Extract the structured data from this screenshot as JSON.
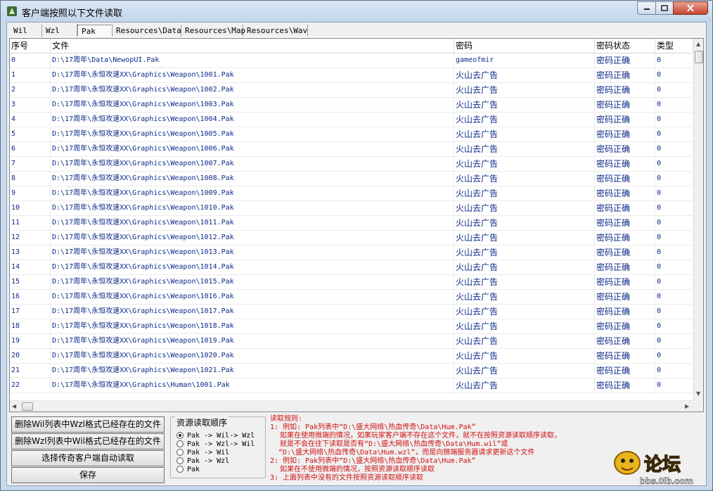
{
  "window": {
    "title": "客户端按照以下文件读取"
  },
  "tabs": [
    "Wil",
    "Wzl",
    "Pak",
    "Resources\\Data",
    "Resources\\Map",
    "Resources\\Wav"
  ],
  "active_tab": "Pak",
  "list": {
    "columns": [
      "序号",
      "文件",
      "密码",
      "密码状态",
      "类型"
    ],
    "rows": [
      [
        "0",
        "D:\\17周年\\Data\\NewopUI.Pak",
        "gameofmir",
        "密码正确",
        "0"
      ],
      [
        "1",
        "D:\\17周年\\永恒攻速XX\\Graphics\\Weapon\\1001.Pak",
        "火山去广告",
        "密码正确",
        "0"
      ],
      [
        "2",
        "D:\\17周年\\永恒攻速XX\\Graphics\\Weapon\\1002.Pak",
        "火山去广告",
        "密码正确",
        "0"
      ],
      [
        "3",
        "D:\\17周年\\永恒攻速XX\\Graphics\\Weapon\\1003.Pak",
        "火山去广告",
        "密码正确",
        "0"
      ],
      [
        "4",
        "D:\\17周年\\永恒攻速XX\\Graphics\\Weapon\\1004.Pak",
        "火山去广告",
        "密码正确",
        "0"
      ],
      [
        "5",
        "D:\\17周年\\永恒攻速XX\\Graphics\\Weapon\\1005.Pak",
        "火山去广告",
        "密码正确",
        "0"
      ],
      [
        "6",
        "D:\\17周年\\永恒攻速XX\\Graphics\\Weapon\\1006.Pak",
        "火山去广告",
        "密码正确",
        "0"
      ],
      [
        "7",
        "D:\\17周年\\永恒攻速XX\\Graphics\\Weapon\\1007.Pak",
        "火山去广告",
        "密码正确",
        "0"
      ],
      [
        "8",
        "D:\\17周年\\永恒攻速XX\\Graphics\\Weapon\\1008.Pak",
        "火山去广告",
        "密码正确",
        "0"
      ],
      [
        "9",
        "D:\\17周年\\永恒攻速XX\\Graphics\\Weapon\\1009.Pak",
        "火山去广告",
        "密码正确",
        "0"
      ],
      [
        "10",
        "D:\\17周年\\永恒攻速XX\\Graphics\\Weapon\\1010.Pak",
        "火山去广告",
        "密码正确",
        "0"
      ],
      [
        "11",
        "D:\\17周年\\永恒攻速XX\\Graphics\\Weapon\\1011.Pak",
        "火山去广告",
        "密码正确",
        "0"
      ],
      [
        "12",
        "D:\\17周年\\永恒攻速XX\\Graphics\\Weapon\\1012.Pak",
        "火山去广告",
        "密码正确",
        "0"
      ],
      [
        "13",
        "D:\\17周年\\永恒攻速XX\\Graphics\\Weapon\\1013.Pak",
        "火山去广告",
        "密码正确",
        "0"
      ],
      [
        "14",
        "D:\\17周年\\永恒攻速XX\\Graphics\\Weapon\\1014.Pak",
        "火山去广告",
        "密码正确",
        "0"
      ],
      [
        "15",
        "D:\\17周年\\永恒攻速XX\\Graphics\\Weapon\\1015.Pak",
        "火山去广告",
        "密码正确",
        "0"
      ],
      [
        "16",
        "D:\\17周年\\永恒攻速XX\\Graphics\\Weapon\\1016.Pak",
        "火山去广告",
        "密码正确",
        "0"
      ],
      [
        "17",
        "D:\\17周年\\永恒攻速XX\\Graphics\\Weapon\\1017.Pak",
        "火山去广告",
        "密码正确",
        "0"
      ],
      [
        "18",
        "D:\\17周年\\永恒攻速XX\\Graphics\\Weapon\\1018.Pak",
        "火山去广告",
        "密码正确",
        "0"
      ],
      [
        "19",
        "D:\\17周年\\永恒攻速XX\\Graphics\\Weapon\\1019.Pak",
        "火山去广告",
        "密码正确",
        "0"
      ],
      [
        "20",
        "D:\\17周年\\永恒攻速XX\\Graphics\\Weapon\\1020.Pak",
        "火山去广告",
        "密码正确",
        "0"
      ],
      [
        "21",
        "D:\\17周年\\永恒攻速XX\\Graphics\\Weapon\\1021.Pak",
        "火山去广告",
        "密码正确",
        "0"
      ],
      [
        "22",
        "D:\\17周年\\永恒攻速XX\\Graphics\\Human\\1001.Pak",
        "火山去广告",
        "密码正确",
        "0"
      ]
    ]
  },
  "buttons": {
    "delete_wil": "删除Wil列表中Wzl格式已经存在的文件",
    "delete_wzl": "删除Wzl列表中Wil格式已经存在的文件",
    "auto_read": "选择传奇客户端自动读取",
    "save": "保存"
  },
  "read_order": {
    "title": "资源读取顺序",
    "options": [
      "Pak -> Wil-> Wzl",
      "Pak -> Wzl-> Wil",
      "Pak -> Wil",
      "Pak -> Wzl",
      "Pak"
    ],
    "selected_index": 0
  },
  "rules": {
    "title": "读取规则:",
    "lines": [
      "1: 例如: Pak列表中“D:\\盛大网络\\热血传奇\\Data\\Hum.Pak”",
      "如果在使用微端的情况，如果玩家客户端不存在这个文件，就不在按照资源读取顺序读取，",
      "就是不会在往下读取是否有“D:\\盛大网络\\热血传奇\\Data\\Hum.wil”或",
      "“D:\\盛大网络\\热血传奇\\Data\\Hum.wzl”，而是向微端服务器请求更新这个文件",
      "2: 例如: Pak列表中“D:\\盛大网络\\热血传奇\\Data\\Hum.Pak”",
      "如果在不使用微端的情况，按照资源读取顺序读取",
      "3: 上面列表中没有的文件按照资源读取顺序读取"
    ]
  },
  "watermark": {
    "text": "bbs.0lb.com",
    "logo_text": "论坛"
  },
  "colors": {
    "list_text": "#0c2a88",
    "rules_text": "#d01010"
  }
}
